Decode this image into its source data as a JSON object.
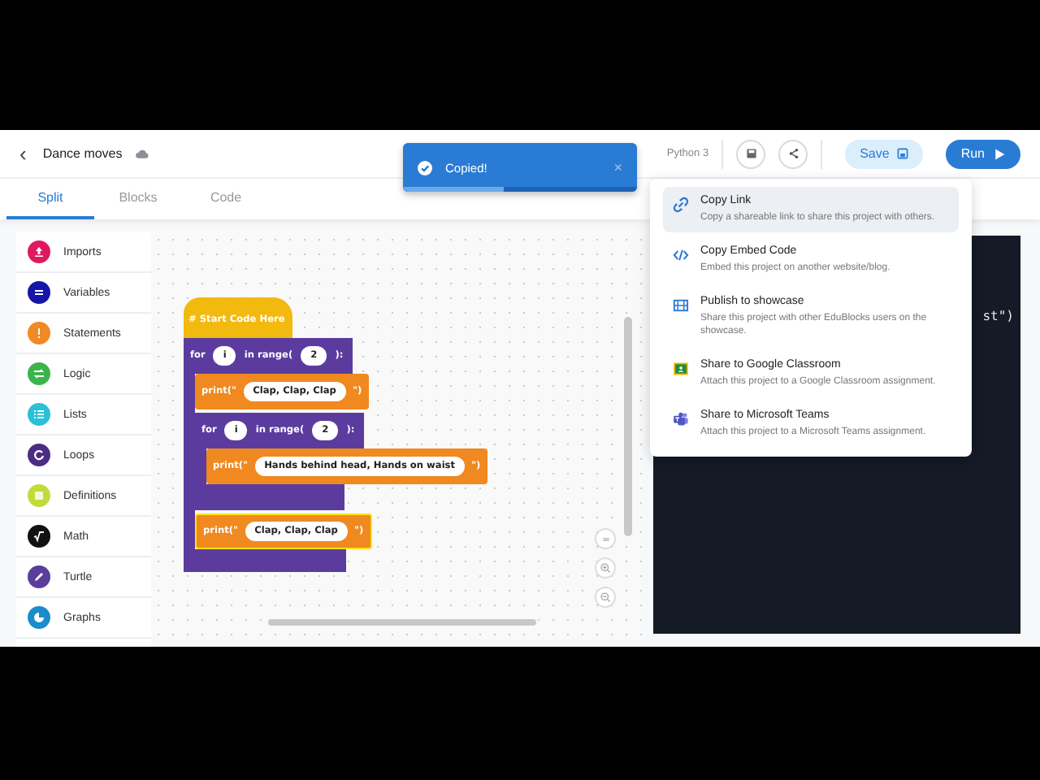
{
  "header": {
    "back": "‹",
    "title": "Dance moves",
    "language": "Python 3",
    "save": "Save",
    "run": "Run"
  },
  "tabs": [
    {
      "label": "Split",
      "selected": true
    },
    {
      "label": "Blocks",
      "selected": false
    },
    {
      "label": "Code",
      "selected": false
    }
  ],
  "toast": {
    "text": "Copied!",
    "close": "×",
    "level": 0.43
  },
  "categories": [
    {
      "label": "Imports",
      "color": "#e0185f",
      "kind": "upload"
    },
    {
      "label": "Variables",
      "color": "#1515a8",
      "kind": "equals"
    },
    {
      "label": "Statements",
      "color": "#f08a24",
      "kind": "bang"
    },
    {
      "label": "Logic",
      "color": "#3cb44b",
      "kind": "swap"
    },
    {
      "label": "Lists",
      "color": "#2bc0d6",
      "kind": "list"
    },
    {
      "label": "Loops",
      "color": "#4b2e83",
      "kind": "loop"
    },
    {
      "label": "Definitions",
      "color": "#c0dc3a",
      "kind": "square"
    },
    {
      "label": "Math",
      "color": "#111111",
      "kind": "root"
    },
    {
      "label": "Turtle",
      "color": "#5b3e9b",
      "kind": "pen"
    },
    {
      "label": "Graphs",
      "color": "#1a8ccc",
      "kind": "pie"
    }
  ],
  "blocks": [
    {
      "kind": "hat",
      "text": "# Start Code Here"
    },
    {
      "kind": "for",
      "keyword": "for",
      "var": "i",
      "range": "in range(",
      "count": "2",
      "close": "):",
      "children": [
        {
          "kind": "print",
          "open": "print(\"",
          "value": "Clap, Clap, Clap",
          "close": "\")",
          "selected": false
        },
        {
          "kind": "for",
          "keyword": "for",
          "var": "i",
          "range": "in range(",
          "count": "2",
          "close": "):",
          "children": [
            {
              "kind": "print",
              "open": "print(\"",
              "value": "Hands behind head, Hands on waist",
              "close": "\")",
              "selected": false
            }
          ]
        },
        {
          "kind": "print",
          "open": "print(\"",
          "value": "Clap, Clap, Clap",
          "close": "\")",
          "selected": true
        }
      ]
    }
  ],
  "code": {
    "fragment": "st\")"
  },
  "share_menu": [
    {
      "kind": "link",
      "title": "Copy Link",
      "desc": "Copy a shareable link to share this project with others.",
      "selected": true
    },
    {
      "kind": "embed",
      "title": "Copy Embed Code",
      "desc": "Embed this project on another website/blog.",
      "selected": false
    },
    {
      "kind": "showcase",
      "title": "Publish to showcase",
      "desc": "Share this project with other EduBlocks users on the showcase.",
      "selected": false
    },
    {
      "kind": "classroom",
      "title": "Share to Google Classroom",
      "desc": "Attach this project to a Google Classroom assignment.",
      "selected": false
    },
    {
      "kind": "teams",
      "title": "Share to Microsoft Teams",
      "desc": "Attach this project to a Microsoft Teams assignment.",
      "selected": false
    }
  ]
}
